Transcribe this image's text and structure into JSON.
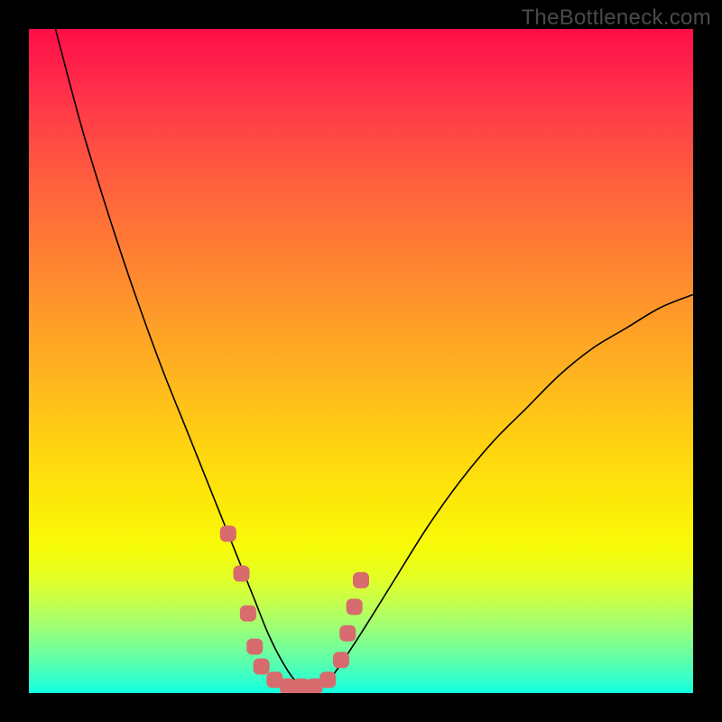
{
  "watermark": "TheBottleneck.com",
  "chart_data": {
    "type": "line",
    "title": "",
    "xlabel": "",
    "ylabel": "",
    "xlim": [
      0,
      100
    ],
    "ylim": [
      0,
      100
    ],
    "grid": false,
    "legend": false,
    "background_gradient": {
      "top": "#ff0e47",
      "mid": "#ffd112",
      "bottom": "#10ffe0",
      "notes": "vertical red→orange→yellow→green cyan gradient representing bottleneck severity (red=high, green=low)"
    },
    "series": [
      {
        "name": "bottleneck-curve",
        "color": "#000000",
        "x": [
          4,
          8,
          12,
          16,
          20,
          24,
          28,
          30,
          32,
          34,
          36,
          38,
          40,
          42,
          44,
          46,
          50,
          55,
          60,
          65,
          70,
          75,
          80,
          85,
          90,
          95,
          100
        ],
        "y": [
          100,
          85,
          72,
          60,
          49,
          39,
          29,
          24,
          19,
          14,
          9,
          5,
          2,
          1,
          1,
          3,
          9,
          17,
          25,
          32,
          38,
          43,
          48,
          52,
          55,
          58,
          60
        ]
      }
    ],
    "markers": {
      "name": "optimal-region",
      "color": "#d86b6d",
      "shape": "rounded-square",
      "points": [
        {
          "x": 30,
          "y": 24
        },
        {
          "x": 32,
          "y": 18
        },
        {
          "x": 33,
          "y": 12
        },
        {
          "x": 34,
          "y": 7
        },
        {
          "x": 35,
          "y": 4
        },
        {
          "x": 37,
          "y": 2
        },
        {
          "x": 39,
          "y": 1
        },
        {
          "x": 41,
          "y": 1
        },
        {
          "x": 43,
          "y": 1
        },
        {
          "x": 45,
          "y": 2
        },
        {
          "x": 47,
          "y": 5
        },
        {
          "x": 48,
          "y": 9
        },
        {
          "x": 49,
          "y": 13
        },
        {
          "x": 50,
          "y": 17
        }
      ]
    }
  }
}
